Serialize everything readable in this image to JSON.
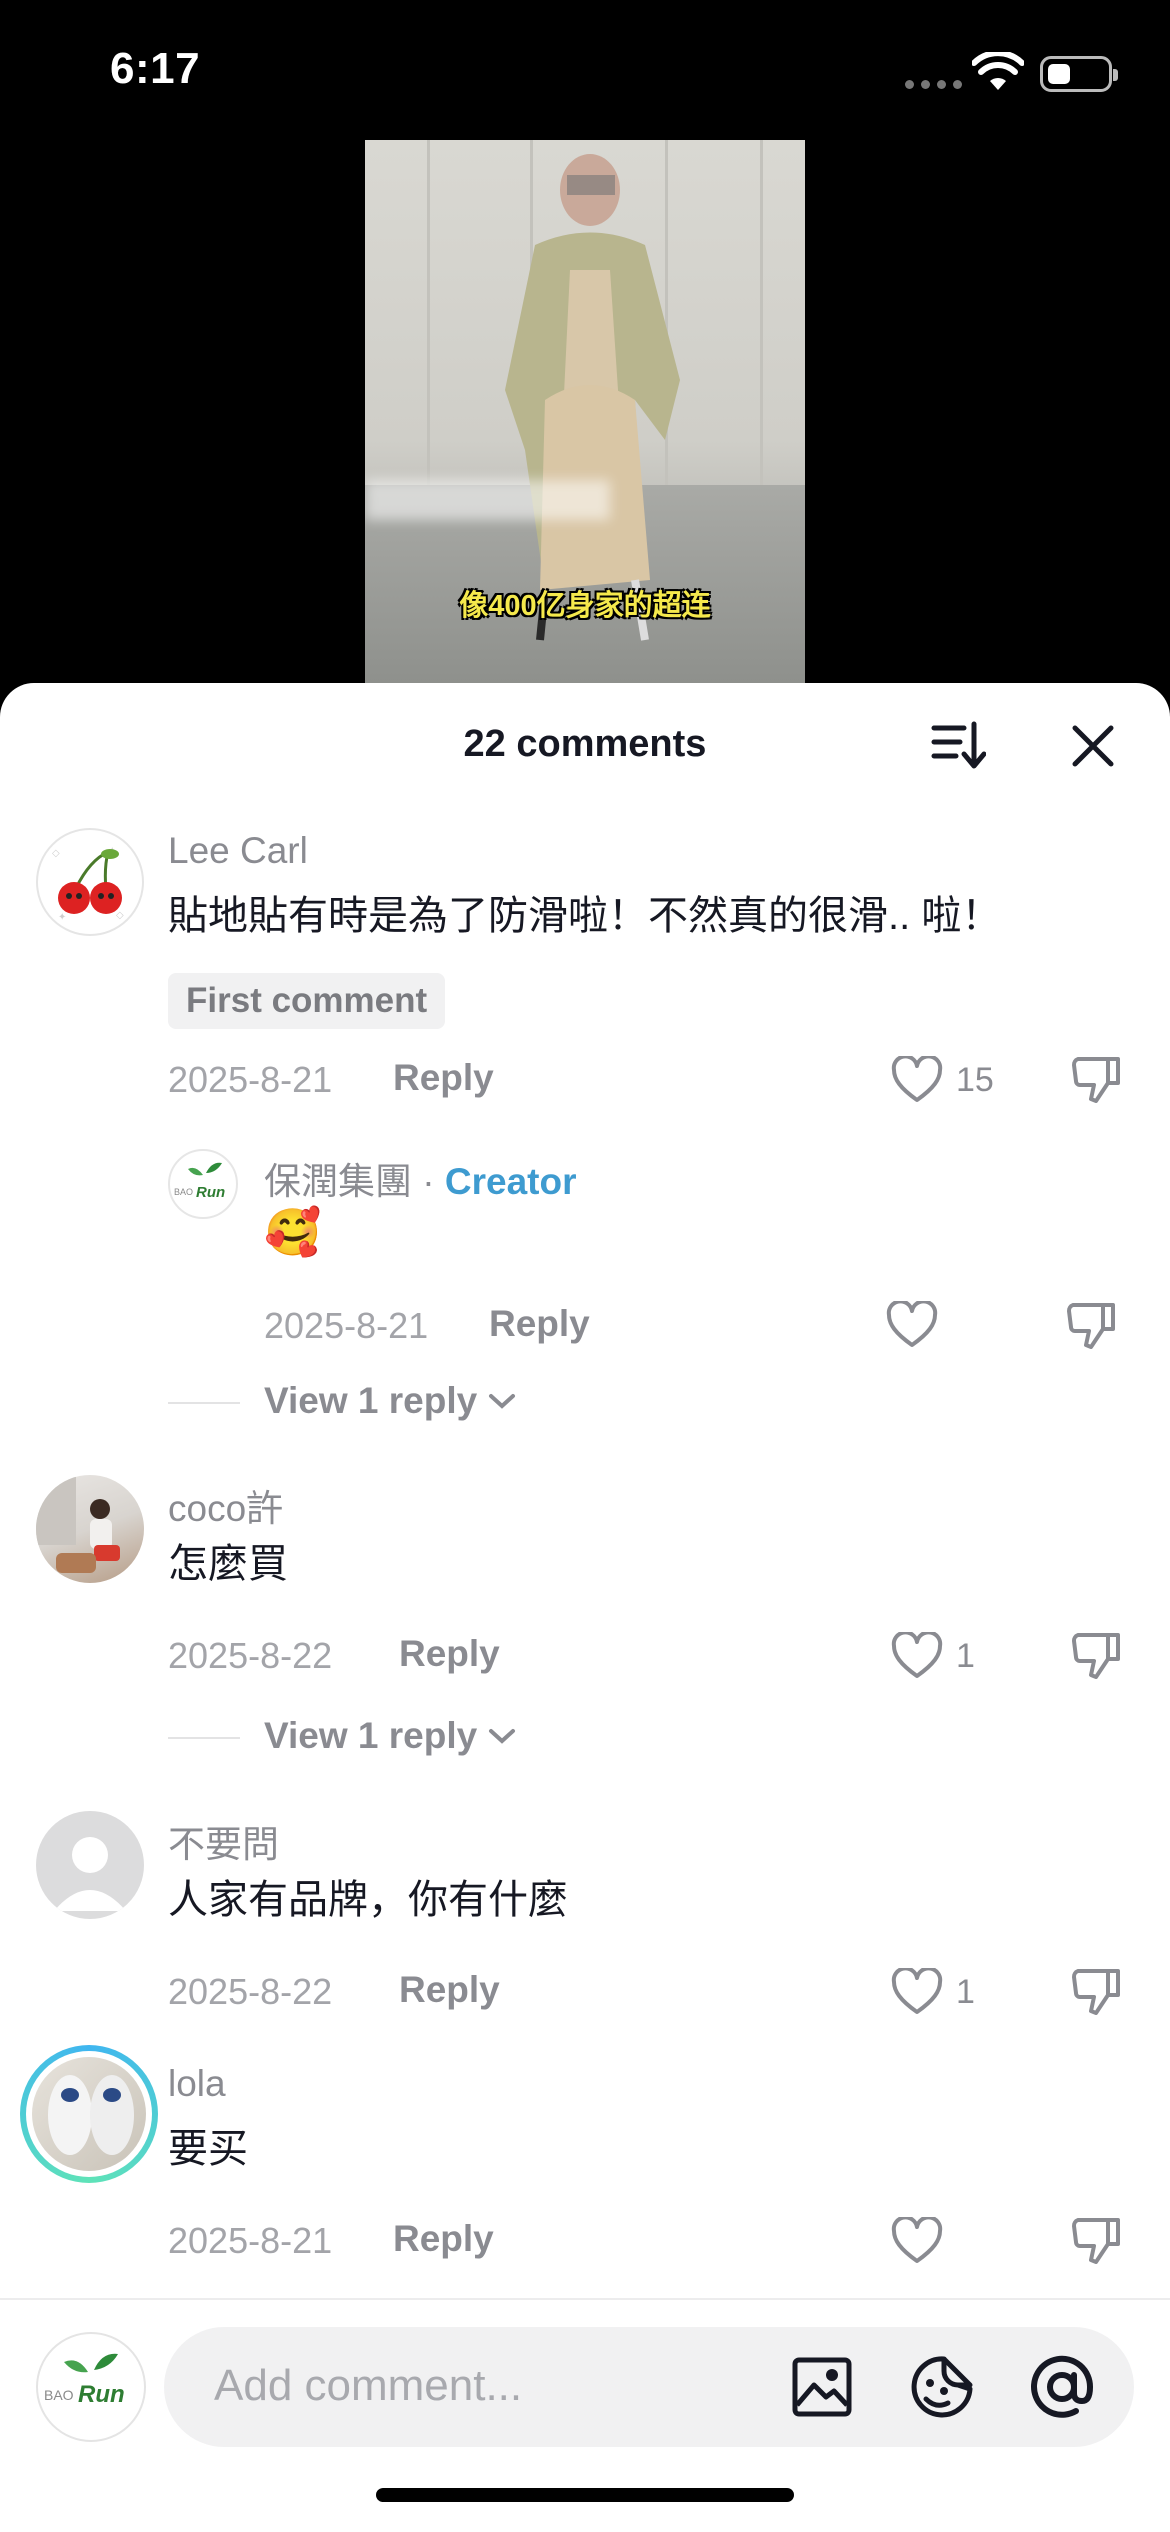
{
  "status_bar": {
    "time": "6:17"
  },
  "video": {
    "subtitle": "像400亿身家的超连"
  },
  "sheet": {
    "title": "22 comments"
  },
  "comments": [
    {
      "username": "Lee Carl",
      "text": "貼地貼有時是為了防滑啦！不然真的很滑.. 啦！",
      "badge": "First comment",
      "date": "2025-8-21",
      "reply": "Reply",
      "likes": "15"
    },
    {
      "username": "保潤集團",
      "separator": " · ",
      "creator_label": "Creator",
      "text": "🥰",
      "date": "2025-8-21",
      "reply": "Reply",
      "likes": ""
    },
    {
      "username": "coco許",
      "text": "怎麼買",
      "date": "2025-8-22",
      "reply": "Reply",
      "likes": "1"
    },
    {
      "username": "不要問",
      "text": "人家有品牌，你有什麼",
      "date": "2025-8-22",
      "reply": "Reply",
      "likes": "1"
    },
    {
      "username": "lola",
      "text": "要买",
      "date": "2025-8-21",
      "reply": "Reply",
      "likes": ""
    }
  ],
  "view_replies": [
    "View 1 reply",
    "View 1 reply"
  ],
  "input": {
    "placeholder": "Add comment..."
  },
  "brand": {
    "logo_text_left": "BAO",
    "logo_text_right": "Run"
  },
  "colors": {
    "creator": "#3e9bd0",
    "text": "#161823",
    "muted": "#8a8b91"
  },
  "icons": [
    "sort-icon",
    "close-icon",
    "heart-icon",
    "dislike-icon",
    "image-icon",
    "emoji-icon",
    "mention-icon"
  ]
}
